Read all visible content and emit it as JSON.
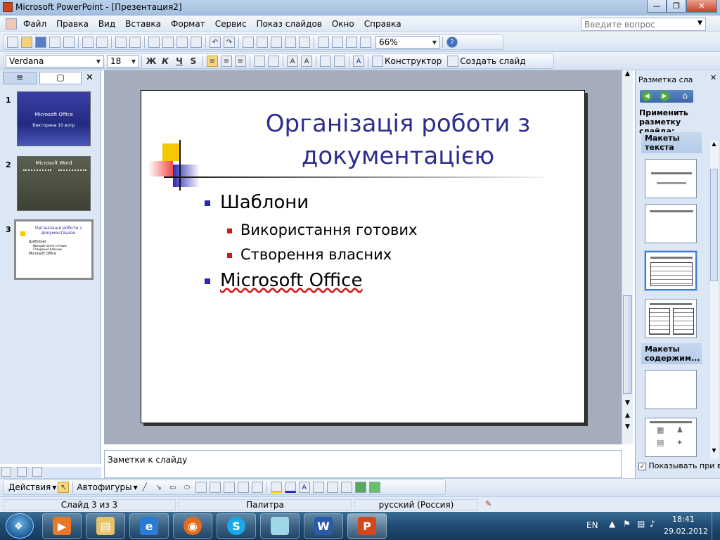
{
  "window": {
    "title": "Microsoft PowerPoint - [Презентация2]"
  },
  "menu": {
    "items": [
      "Файл",
      "Правка",
      "Вид",
      "Вставка",
      "Формат",
      "Сервис",
      "Показ слайдов",
      "Окно",
      "Справка"
    ],
    "help_placeholder": "Введите вопрос"
  },
  "toolbar": {
    "zoom": "66%"
  },
  "format_toolbar": {
    "font": "Verdana",
    "size": "18",
    "bold": "Ж",
    "italic": "К",
    "underline": "Ч",
    "shadow": "S",
    "designer": "Конструктор",
    "new_slide": "Создать слайд"
  },
  "slides_panel": {
    "numbers": [
      "1",
      "2",
      "3"
    ],
    "thumb1": {
      "title": "Microsoft Office",
      "subtitle": "Викторина 10 вопр"
    },
    "thumb2": {
      "title": "Microsoft Word"
    },
    "thumb3": {
      "title": "Організація роботи з документацією",
      "items": [
        "Шаблони",
        "Використання готових",
        "Створення власних",
        "Microsoft Office"
      ]
    }
  },
  "slide": {
    "title": "Організація роботи з документацією",
    "bullets": [
      {
        "text": "Шаблони",
        "level": 1
      },
      {
        "text": "Використання готових",
        "level": 2
      },
      {
        "text": "Створення власних",
        "level": 2
      },
      {
        "text": "Microsoft Office",
        "level": 1
      }
    ],
    "colors": {
      "title": "#2d2d8f",
      "bullet1": "#2a2ab4",
      "bullet2": "#d41515"
    }
  },
  "notes": {
    "placeholder": "Заметки к слайду"
  },
  "taskpane": {
    "title": "Разметка сла",
    "apply_label": "Применить разметку слайда:",
    "section_text": "Макеты текста",
    "section_content": "Макеты содержим...",
    "show_on_insert": "Показывать при вс"
  },
  "drawbar": {
    "actions": "Действия",
    "autoshapes": "Автофигуры"
  },
  "status": {
    "slide": "Слайд 3 из 3",
    "design": "Палитра",
    "language": "русский (Россия)"
  },
  "taskbar": {
    "lang": "EN",
    "time": "18:41",
    "date": "29.02.2012"
  }
}
